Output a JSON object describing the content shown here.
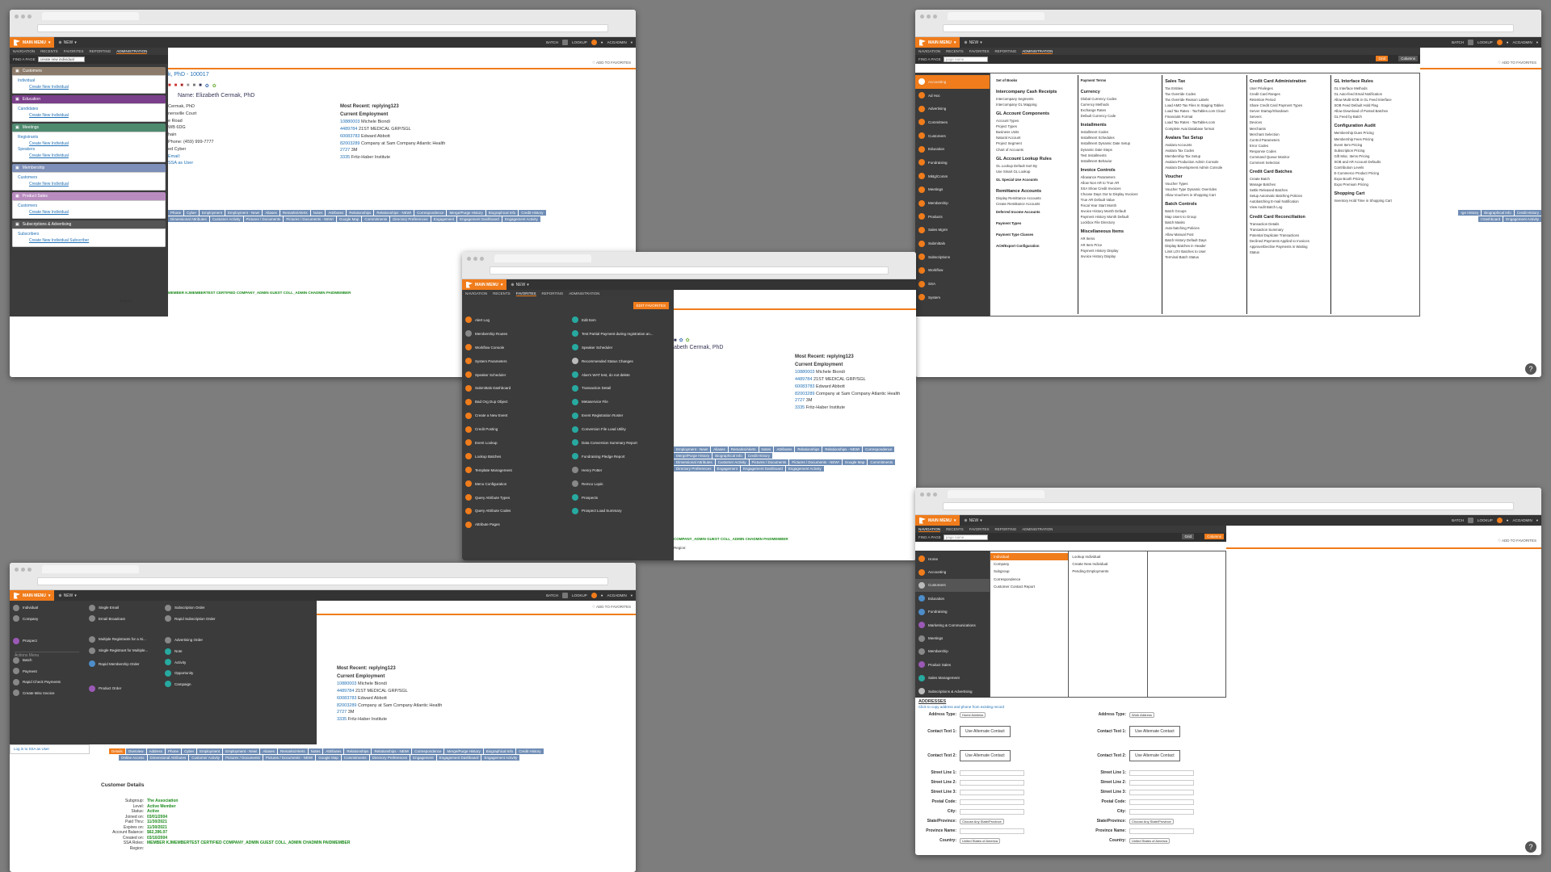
{
  "topbar": {
    "main_menu": "MAIN MENU",
    "new": "NEW",
    "batch": "BATCH",
    "lookup": "LOOKUP",
    "user": "ACGADMIN",
    "add_fav": "ADD TO FAVORITES"
  },
  "nav_tabs": [
    "NAVIGATION",
    "RECENTS",
    "FAVORITES",
    "REPORTING",
    "ADMINISTRATION"
  ],
  "find_label": "FIND A PAGE",
  "record": {
    "header": "k, PhD - 100017",
    "name": "Name: Elizabeth Cermak, PhD",
    "left_lines": [
      "Cermak, PhD",
      "nersville Court",
      "e Road",
      "WB 6DG",
      "hain",
      "Phone: (459) 999-7777",
      "ed Cyber",
      "Email: ",
      "SSA as User"
    ],
    "most_recent": "Most Recent: replying123",
    "current_emp": "Current Employment",
    "emps": [
      {
        "id": "10880003",
        "org": "Michele Biondi"
      },
      {
        "id": "4489784",
        "org": "21ST MEDICAL GRP/SGL"
      },
      {
        "id": "60083783",
        "org": "Edward Abbott"
      },
      {
        "id": "82003289",
        "org": "Company at Sam Company Atlantic Health"
      },
      {
        "id": "2727",
        "org": "3M"
      },
      {
        "id": "3335",
        "org": "Fritz-Haber Institute"
      }
    ],
    "ssa": "MEMBER KJMEMBERTEST CERTIFIED COMPANY_ADMIN GUEST COLL_ADMIN CHADMIN PAIDMEMBER",
    "region": "Region:"
  },
  "tabs_row1": [
    "Details",
    "Overview",
    "Address",
    "Phone",
    "Cyber",
    "Employment",
    "Employment - New!",
    "Aliases",
    "Remarks/Alerts",
    "Notes",
    "Attributes",
    "Relationships",
    "Relationships - NEW!",
    "Correspondence",
    "Merge/Purge History",
    "Biographical Info",
    "Credit History"
  ],
  "tabs_row2": [
    "Online Access",
    "Dimensional Attributes",
    "Customer Activity",
    "Pictures / Documents",
    "Pictures / Documents - NEW!",
    "Google Map",
    "Commitments",
    "Directory Preferences",
    "Engagement",
    "Engagement Dashboard",
    "Engagement Activity"
  ],
  "win1": {
    "find_value": "create new individual",
    "sections": [
      {
        "title": "Customers",
        "color": "#8c7b6a",
        "items": [
          [
            "Individual",
            "Create New Individual"
          ]
        ]
      },
      {
        "title": "Education",
        "color": "#7a3f8a",
        "items": [
          [
            "Candidates",
            "Create New Individual"
          ]
        ]
      },
      {
        "title": "Meetings",
        "color": "#4e8a6e",
        "items": [
          [
            "Registrants",
            "Create New Individual"
          ],
          [
            "Speakers",
            "Create New Individual"
          ]
        ]
      },
      {
        "title": "Membership",
        "color": "#7d8fb8",
        "items": [
          [
            "Customers",
            "Create New Individual"
          ]
        ]
      },
      {
        "title": "Product Sales",
        "color": "#b98cc0",
        "items": [
          [
            "Customers",
            "Create New Individual"
          ]
        ]
      },
      {
        "title": "Subscriptions & Advertising",
        "color": "#555",
        "items": [
          [
            "Subscribers",
            "Create New Individual Subscriber"
          ]
        ]
      }
    ]
  },
  "win2": {
    "find_value": "page name",
    "grid": "Grid",
    "columns": "Columns",
    "sidebar": [
      "Accounting",
      "Ad Hoc",
      "Advertising",
      "Committees",
      "Customers",
      "Education",
      "Fundraising",
      "Mktg/Comm",
      "Meetings",
      "Membership",
      "Products",
      "Sales Mgmt",
      "Submittals",
      "Subscriptions",
      "Workflow",
      "SSA",
      "System"
    ],
    "cols": [
      [
        {
          "h": "Set of Books",
          "items": []
        },
        {
          "h": "Intercompany Cash Receipts",
          "items": [
            "Intercompany Segments",
            "Intercompany GL Mapping"
          ]
        },
        {
          "h": "GL Account Components",
          "items": [
            "Account Types",
            "Project Types",
            "Business Units",
            "Natural Account",
            "Project Segment",
            "Chart of Accounts"
          ]
        },
        {
          "h": "GL Account Lookup Rules",
          "items": [
            "GL Lookup Default Sort By",
            "Use Smart GL Lookup"
          ]
        },
        {
          "h": "GL Special Use Accounts",
          "items": []
        },
        {
          "h": "Remittance Accounts",
          "items": [
            "Display Remittance Accounts",
            "Create Remittance Accounts"
          ]
        },
        {
          "h": "Deferred Income Accounts",
          "items": []
        },
        {
          "h": "Payment Types",
          "items": []
        },
        {
          "h": "Payment Type Classes",
          "items": []
        },
        {
          "h": "ACH/Export Configuration",
          "items": []
        }
      ],
      [
        {
          "h": "Payment Terms",
          "items": []
        },
        {
          "h": "Currency",
          "items": [
            "Global Currency Codes",
            "Currency Methods",
            "Exchange Rates",
            "Default Currency Code"
          ]
        },
        {
          "h": "Installments",
          "items": [
            "Installment Codes",
            "Installment Schedules",
            "Installment Dynamic Date Setup",
            "Dynamic Date Steps",
            "Test Installments",
            "Installment Behavior"
          ]
        },
        {
          "h": "Invoice Controls",
          "items": [
            "Allowance Parameters",
            "Allow Non AR to True AR",
            "SSA Show Credit Invoices",
            "Choose Days Out to Display Invoices",
            "True AR Default Value",
            "Fiscal Year Start Month",
            "Invoice History Month Default",
            "Payment History Month Default",
            "Lockbox File Directory"
          ]
        },
        {
          "h": "Miscellaneous Items",
          "items": [
            "AR Items",
            "AR Item Price",
            "Payment History Display",
            "Invoice History Display"
          ]
        }
      ],
      [
        {
          "h": "Sales Tax",
          "items": [
            "Tax Entities",
            "Tax Override Codes",
            "Tax Override Reason Labels",
            "Load AMO Tax Files In Staging Tables",
            "Load Tax Rates - TaxTables.com Cloud",
            "Financials Format",
            "Load Tax Rates - TaxTables.com",
            "Complete Avai Database format"
          ]
        },
        {
          "h": "Avalara Tax Setup",
          "items": [
            "Avalara Accounts",
            "Avalara Tax Codes",
            "Membership Tax Setup",
            "Avalara Production Admin Console",
            "Avalara Development Admin Console"
          ]
        },
        {
          "h": "Voucher",
          "items": [
            "Voucher Types",
            "Voucher Type Dynamic Overrides",
            "Allow Vouchers in Shopping Cart"
          ]
        },
        {
          "h": "Batch Controls",
          "items": [
            "Batch Groups",
            "Map Users to Group",
            "Batch Masks",
            "Auto-batching Policies",
            "Allow Manual Post",
            "Batch History Default Days",
            "Display Batches in Header",
            "Limit LOV Batches to User",
            "Terminal Batch Status"
          ]
        }
      ],
      [
        {
          "h": "Credit Card Administration",
          "items": [
            "User Privileges",
            "Credit Card Ranges",
            "Retention Period",
            "Share Credit Card Payment Types",
            "Server Startup/Shutdown",
            "Servers",
            "Devices",
            "Merchants",
            "Merchant Selection",
            "Control Parameters",
            "Error Codes",
            "Response Codes",
            "Command Queue Monitor",
            "Comment Selection"
          ]
        },
        {
          "h": "Credit Card Batches",
          "items": [
            "Create Batch",
            "Manage Batches",
            "Settle Released Batches",
            "Setup Automatic Batching Policies",
            "Autobatching E-mail Notification",
            "View Audit Batch Log"
          ]
        },
        {
          "h": "Credit Card Reconciliation",
          "items": [
            "Transaction Details",
            "Transaction Summary",
            "Potential Duplicate Transactions",
            "Declined Payments Applied to Invoices",
            "Approve/Decline Payments in Waiting",
            "Status"
          ]
        }
      ],
      [
        {
          "h": "GL Interface Rules",
          "items": [
            "GL Interface Methods",
            "GL Auto-feed Email Notification",
            "Allow Multi-SOB in GL Feed Interface",
            "SOB Feed Default Hold Flag",
            "Allow Download of Posted Batches",
            "GL Feed by Batch"
          ]
        },
        {
          "h": "Configuration Audit",
          "items": [
            "Membership Dues Pricing",
            "Membership Fees Pricing",
            "Event Item Pricing",
            "Subscription Pricing",
            "Gift Misc. Items Pricing",
            "SOB and AR Account Defaults",
            "Contribution Levels",
            "E-Commerce Product Pricing",
            "Expo Booth Pricing",
            "Expo Premium Pricing"
          ]
        },
        {
          "h": "Shopping Cart",
          "items": [
            "Inventory Hold Time in Shopping Cart"
          ]
        }
      ]
    ]
  },
  "win3": {
    "edit_favorites": "EDIT FAVORITES",
    "left": [
      [
        "Alert Log",
        "o"
      ],
      [
        "Membership Routes",
        "g"
      ],
      [
        "Workflow Console",
        "o"
      ],
      [
        "System Parameters",
        "o"
      ],
      [
        "Speaker Scheduler",
        "o"
      ],
      [
        "Submittals Dashboard",
        "o"
      ],
      [
        "Bad Org Dup Object",
        "o"
      ],
      [
        "Create a New Event",
        "o"
      ],
      [
        "Credit Posting",
        "o"
      ],
      [
        "Event Lookup",
        "o"
      ],
      [
        "Lookup Batches",
        "o"
      ],
      [
        "Template Management",
        "o"
      ],
      [
        "Menu Configuration",
        "o"
      ],
      [
        "Query Attribute Types",
        "o"
      ],
      [
        "Query Attribute Codes",
        "o"
      ],
      [
        "Attribute Pages",
        "o"
      ]
    ],
    "right": [
      [
        "Edit Item",
        "t"
      ],
      [
        "Test Partial Payment during registration an...",
        "t"
      ],
      [
        "Speaker Scheduler",
        "t"
      ],
      [
        "Recommended Status Changes",
        "w"
      ],
      [
        "Alan's WAT test, do not delete",
        "t"
      ],
      [
        "Transaction Detail",
        "t"
      ],
      [
        "Metaservice File",
        "t"
      ],
      [
        "Event Registration Roster",
        "t"
      ],
      [
        "Conversion File Load Utility",
        "t"
      ],
      [
        "Data Conversion Summary Report",
        "t"
      ],
      [
        "Fundraising Pledge Report",
        "t"
      ],
      [
        "Henry Potter",
        "g"
      ],
      [
        "Remco Lopin",
        "g"
      ],
      [
        "Prospects",
        "t"
      ],
      [
        "Prospect Load Summary",
        "t"
      ]
    ]
  },
  "win4": {
    "col1": [
      [
        "Individual",
        "g"
      ],
      [
        "Company",
        "g"
      ],
      [
        "Prospect",
        "p"
      ],
      [
        "Batch",
        "g"
      ],
      [
        "Payment",
        "g"
      ],
      [
        "Rapid Check Payments",
        "g"
      ],
      [
        "Create Misc Invoice",
        "g"
      ]
    ],
    "col2": [
      [
        "Single Email",
        "g"
      ],
      [
        "Email Broadcast",
        "g"
      ],
      [
        "Multiple Registrants for a Si...",
        "g"
      ],
      [
        "Single Registrant for Multiple...",
        "g"
      ],
      [
        "Rapid Membership Order",
        "b"
      ],
      [
        "Product Order",
        "p"
      ]
    ],
    "col3": [
      [
        "Subscription Order",
        "g"
      ],
      [
        "Rapid Subscription Order",
        "g"
      ],
      [
        "Advertising Order",
        "g"
      ],
      [
        "Note",
        "t"
      ],
      [
        "Activity",
        "t"
      ],
      [
        "Opportunity",
        "t"
      ],
      [
        "Campaign",
        "t"
      ]
    ],
    "actions": "Actions Menu",
    "log_ssa": "Log in to SSA as User",
    "cust_details": "Customer Details",
    "details": [
      [
        "Subgroup:",
        "The Association"
      ],
      [
        "Level:",
        "Active Member"
      ],
      [
        "Status:",
        "Active"
      ],
      [
        "Joined on:",
        "03/01/2004"
      ],
      [
        "Paid Thru:",
        "11/30/2021"
      ],
      [
        "Expires on:",
        "11/30/2021"
      ],
      [
        "Account Balance:",
        "$62,396.07"
      ],
      [
        "Created on:",
        "03/10/2004"
      ],
      [
        "SSA Roles:",
        "MEMBER KJMEMBERTEST CERTIFIED COMPANY_ADMIN GUEST COLL_ADMIN CHADMIN PAIDMEMBER"
      ],
      [
        "Region:",
        ""
      ]
    ]
  },
  "win5": {
    "find_value": "page name",
    "grid": "Grid",
    "columns": "Columns",
    "sidebar": [
      "Home",
      "Accounting",
      "Customers",
      "Education",
      "Fundraising",
      "Marketing & Communications",
      "Meetings",
      "Membership",
      "Product Sales",
      "Sales Management",
      "Subscriptions & Advertising"
    ],
    "l2": [
      "Individual",
      "Company",
      "Subgroup",
      "Correspondence",
      "Customer Contact Report"
    ],
    "l3": [
      "Lookup Individual",
      "Create New Individual",
      "Pending Employments"
    ],
    "addresses": "ADDRESSES",
    "copy_link": "Click to copy address and phone from existing record",
    "fields": [
      "Address Type:",
      "Contact Text 1:",
      "Contact Text 2:",
      "Street Line 1:",
      "Street Line 2:",
      "Street Line 3:",
      "Postal Code:",
      "City:",
      "State/Province:",
      "Province Name:",
      "Country:"
    ],
    "home_addr": "Home Address",
    "work_addr": "Work Address",
    "alt_contact": "Use Alternate Contact",
    "state_opt": "Choose Any State/Province",
    "country_opt": "United States of America"
  },
  "help": "?"
}
